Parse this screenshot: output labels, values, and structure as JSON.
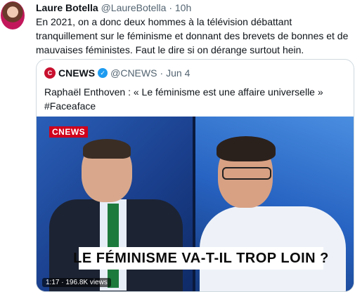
{
  "tweet": {
    "author_name": "Laure Botella",
    "author_handle": "@LaureBotella",
    "separator": "·",
    "time": "10h",
    "text": "En 2021, on a donc deux hommes à la télévision débattant tranquillement sur le féminisme et donnant des brevets de bonnes et de mauvaises féministes. Faut le dire si on dérange surtout hein."
  },
  "quoted_tweet": {
    "logo_text": "C",
    "author_name": "CNEWS",
    "verified_mark": "✓",
    "author_handle": "@CNEWS",
    "separator": "·",
    "date": "Jun 4",
    "text": "Raphaël Enthoven : « Le féminisme est une affaire universelle » #Faceaface",
    "media": {
      "channel_badge": "CNEWS",
      "caption": "LE FÉMINISME VA-T-IL TROP LOIN ?",
      "video_info": "1:17 · 196.8K views"
    }
  },
  "colors": {
    "accent_blue": "#1d9bf0",
    "cnews_red": "#c8102e",
    "text_primary": "#0f1419",
    "text_secondary": "#536471",
    "border": "#cfd9de"
  }
}
